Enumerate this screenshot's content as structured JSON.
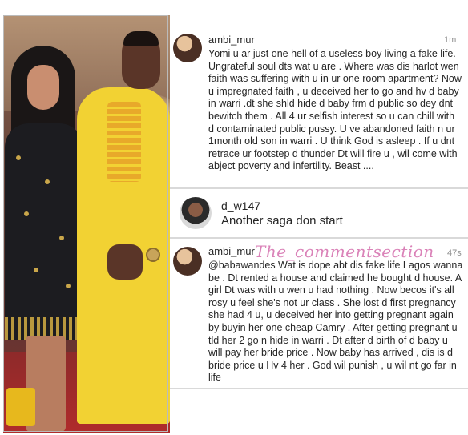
{
  "comments": [
    {
      "username": "ambi_mur",
      "time": "1m",
      "text": "Yomi u ar just one hell of a useless boy living a fake life. Ungrateful soul dts wat u are . Where was dis harlot wen faith was suffering with u in ur one room apartment? Now u impregnated faith , u deceived her to go and hv d baby in warri .dt she shld hide d baby frm d public so dey dnt bewitch them . All 4 ur selfish interest so u can chill with d contaminated public pussy. U ve abandoned faith n ur 1month old son in warri . U think God is asleep . If u dnt retrace ur footstep d thunder Dt will fire u , wil come with abject poverty and infertility. Beast ...."
    },
    {
      "username": "d_w147",
      "text": "Another saga don start"
    },
    {
      "username": "ambi_mur",
      "time": "47s",
      "text": "@babawandes Wat is dope abt dis fake life Lagos wanna be . Dt rented a house and claimed he bought d house. A girl Dt was with u wen u had nothing . Now becos it's all rosy u feel she's not ur class . She lost d first pregnancy she had 4 u, u deceived her into getting pregnant again by buyin her one cheap Camry . After getting pregnant u tld her 2 go n hide in warri . Dt after d birth of d baby u will pay her bride price . Now baby has arrived , dis is d bride price u Hv 4 her . God wil punish , u wil nt go far in life"
    }
  ],
  "watermark": "The_commentsection"
}
